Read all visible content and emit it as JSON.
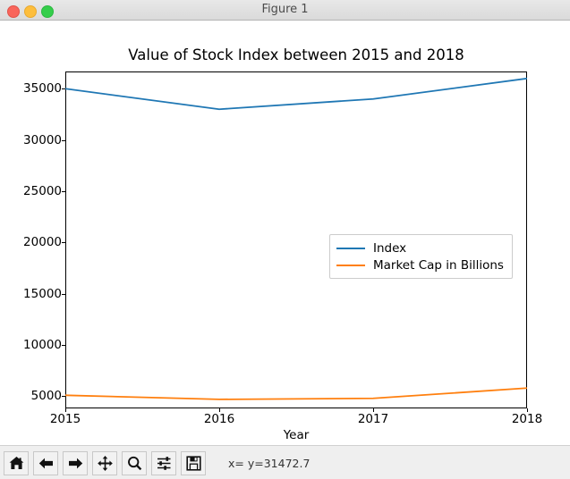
{
  "window": {
    "title": "Figure 1",
    "controls": [
      {
        "name": "close",
        "color": "#f9655b"
      },
      {
        "name": "minimize",
        "color": "#fdbe3d"
      },
      {
        "name": "maximize",
        "color": "#35ce4b"
      }
    ]
  },
  "chart_data": {
    "type": "line",
    "title": "Value of Stock Index between 2015 and 2018",
    "xlabel": "Year",
    "ylabel": "",
    "x": [
      2015,
      2016,
      2017,
      2018
    ],
    "xticklabels": [
      "2015",
      "2016",
      "2017",
      "2018"
    ],
    "yticks": [
      5000,
      10000,
      15000,
      20000,
      25000,
      30000,
      35000
    ],
    "yticklabels": [
      "5000",
      "10000",
      "15000",
      "20000",
      "25000",
      "30000",
      "35000"
    ],
    "xlim": [
      2015,
      2018
    ],
    "ylim": [
      3820,
      36680
    ],
    "grid": false,
    "legend_position": "center right",
    "series": [
      {
        "name": "Index",
        "color": "#1f77b4",
        "values": [
          35000,
          33000,
          34000,
          36000
        ]
      },
      {
        "name": "Market Cap in Billions",
        "color": "#ff7f0e",
        "values": [
          5100,
          4700,
          4800,
          5800
        ]
      }
    ]
  },
  "toolbar": {
    "buttons": [
      {
        "name": "home",
        "tooltip": "Home"
      },
      {
        "name": "back",
        "tooltip": "Back"
      },
      {
        "name": "forward",
        "tooltip": "Forward"
      },
      {
        "name": "pan",
        "tooltip": "Pan"
      },
      {
        "name": "zoom",
        "tooltip": "Zoom"
      },
      {
        "name": "configure-subplots",
        "tooltip": "Configure subplots"
      },
      {
        "name": "save",
        "tooltip": "Save"
      }
    ],
    "status": "x= y=31472.7"
  }
}
